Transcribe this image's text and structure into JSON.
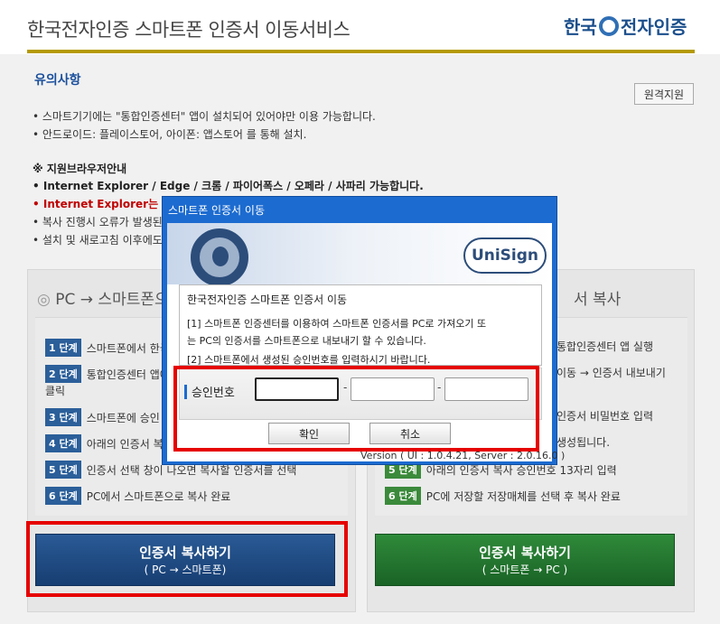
{
  "header": {
    "title": "한국전자인증 스마트폰 인증서 이동서비스",
    "brand": [
      "한국",
      "전자인증"
    ]
  },
  "notice": {
    "title": "유의사항",
    "remote_support": "원격지원",
    "lines": [
      "• 스마트기기에는 \"통합인증센터\" 앱이 설치되어 있어야만 이용 가능합니다.",
      "• 안드로이드: 플레이스토어, 아이폰: 앱스토어 를 통해 설치."
    ],
    "browser_title": "※ 지원브라우저안내",
    "browser_list": "• Internet Explorer / Edge / 크롬 / 파이어폭스 / 오페라 / 사파리 가능합니다.",
    "ie_warning": "• Internet Explorer는 IE",
    "copy_error": "• 복사 진행시 오류가 발생된",
    "refresh_note": "• 설치 및 새로고침 이후에도"
  },
  "left_panel": {
    "heading": "PC → 스마트폰으",
    "steps": [
      {
        "badge": "1 단계",
        "text": "스마트폰에서 한국"
      },
      {
        "badge": "2 단계",
        "text": "통합인증센터 앱에"
      },
      {
        "badge": "",
        "text": "클릭"
      },
      {
        "badge": "3 단계",
        "text": "스마트폰에 승인"
      },
      {
        "badge": "4 단계",
        "text": "아래의 인증서 복"
      },
      {
        "badge": "5 단계",
        "text": "인증서 선택 창이 나오면 복사할 인증서를 선택"
      },
      {
        "badge": "6 단계",
        "text": "PC에서 스마트폰으로 복사 완료"
      }
    ],
    "button_main": "인증서 복사하기",
    "button_sub": "( PC → 스마트폰)"
  },
  "right_panel": {
    "heading": "서 복사",
    "steps": [
      {
        "badge": "",
        "text": "통합인증센터 앱 실행"
      },
      {
        "badge": "",
        "text": "이동 → 인증서 내보내기"
      },
      {
        "badge": "",
        "text": "인증서 비밀번호 입력"
      },
      {
        "badge": "",
        "text": "생성됩니다."
      },
      {
        "badge": "5 단계",
        "text": "아래의 인증서 복사 승인번호 13자리 입력"
      },
      {
        "badge": "6 단계",
        "text": "PC에 저장할 저장매체를 선택 후 복사 완료"
      }
    ],
    "button_main": "인증서 복사하기",
    "button_sub": "( 스마트폰 → PC )"
  },
  "dialog": {
    "title": "스마트폰 인증서 이동",
    "logo": "UniSign",
    "content_title": "한국전자인증 스마트폰 인증서 이동",
    "line1": "[1] 스마트폰 인증센터를 이용하여 스마트폰 인증서를 PC로 가져오기 또",
    "line2": "는 PC의 인증서를 스마트폰으로 내보내기 할 수 있습니다.",
    "line3": "[2] 스마트폰에서 생성된 승인번호를 입력하시기 바랍니다.",
    "approval_label": "승인번호",
    "separator": "-",
    "confirm": "확인",
    "cancel": "취소",
    "version": "Version ( UI : 1.0.4.21, Server : 2.0.16.0 )"
  },
  "colors": {
    "accent_bar": "#b59a00",
    "dialog_blue": "#1c6bd0",
    "highlight_red": "#e60000"
  }
}
